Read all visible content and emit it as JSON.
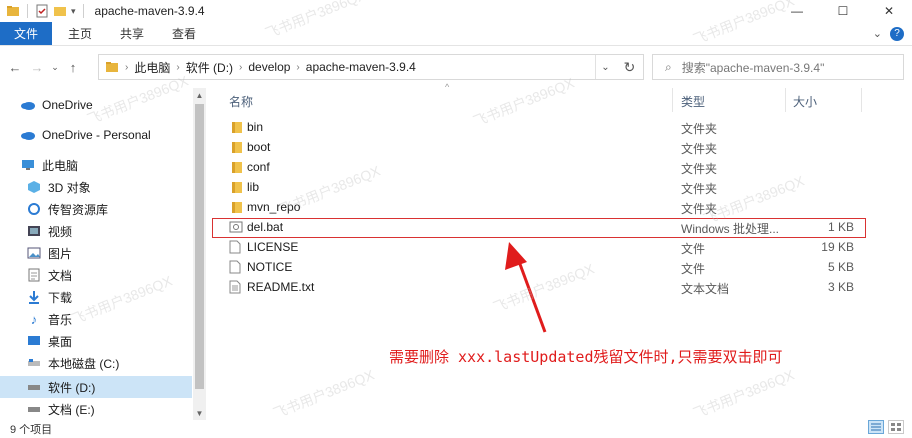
{
  "window": {
    "title": "apache-maven-3.9.4",
    "minimize_icon": "minimize-icon",
    "maximize_icon": "maximize-icon",
    "close_icon": "close-icon"
  },
  "ribbon": {
    "tabs": [
      "文件",
      "主页",
      "共享",
      "查看"
    ]
  },
  "address": {
    "crumbs": [
      "此电脑",
      "软件 (D:)",
      "develop",
      "apache-maven-3.9.4"
    ],
    "search_placeholder": "搜索\"apache-maven-3.9.4\""
  },
  "sidebar": {
    "items": [
      {
        "label": "OneDrive",
        "icon": "cloud-icon"
      },
      {
        "label": "OneDrive - Personal",
        "icon": "cloud-icon"
      },
      {
        "label": "此电脑",
        "icon": "computer-icon"
      },
      {
        "label": "3D 对象",
        "icon": "cube-icon"
      },
      {
        "label": "传智资源库",
        "icon": "library-icon"
      },
      {
        "label": "视频",
        "icon": "video-icon"
      },
      {
        "label": "图片",
        "icon": "picture-icon"
      },
      {
        "label": "文档",
        "icon": "document-icon"
      },
      {
        "label": "下载",
        "icon": "download-icon"
      },
      {
        "label": "音乐",
        "icon": "music-icon"
      },
      {
        "label": "桌面",
        "icon": "desktop-icon"
      },
      {
        "label": "本地磁盘 (C:)",
        "icon": "drive-icon"
      },
      {
        "label": "软件 (D:)",
        "icon": "drive-icon"
      },
      {
        "label": "文档 (E:)",
        "icon": "drive-icon"
      }
    ]
  },
  "columns": {
    "name": "名称",
    "type": "类型",
    "size": "大小"
  },
  "files": [
    {
      "name": "bin",
      "type": "文件夹",
      "size": "",
      "icon": "folder-icon"
    },
    {
      "name": "boot",
      "type": "文件夹",
      "size": "",
      "icon": "folder-icon"
    },
    {
      "name": "conf",
      "type": "文件夹",
      "size": "",
      "icon": "folder-icon"
    },
    {
      "name": "lib",
      "type": "文件夹",
      "size": "",
      "icon": "folder-icon"
    },
    {
      "name": "mvn_repo",
      "type": "文件夹",
      "size": "",
      "icon": "folder-icon"
    },
    {
      "name": "del.bat",
      "type": "Windows 批处理...",
      "size": "1 KB",
      "icon": "batch-file-icon"
    },
    {
      "name": "LICENSE",
      "type": "文件",
      "size": "19 KB",
      "icon": "file-icon"
    },
    {
      "name": "NOTICE",
      "type": "文件",
      "size": "5 KB",
      "icon": "file-icon"
    },
    {
      "name": "README.txt",
      "type": "文本文档",
      "size": "3 KB",
      "icon": "text-file-icon"
    }
  ],
  "annotation": "需要删除 xxx.lastUpdated残留文件时,只需要双击即可",
  "watermark": "飞书用户3896QX",
  "status": {
    "count": "9 个项目"
  },
  "colors": {
    "accent": "#1e6dc6",
    "selection": "#cce4f7",
    "annotation": "#e01c1c"
  }
}
